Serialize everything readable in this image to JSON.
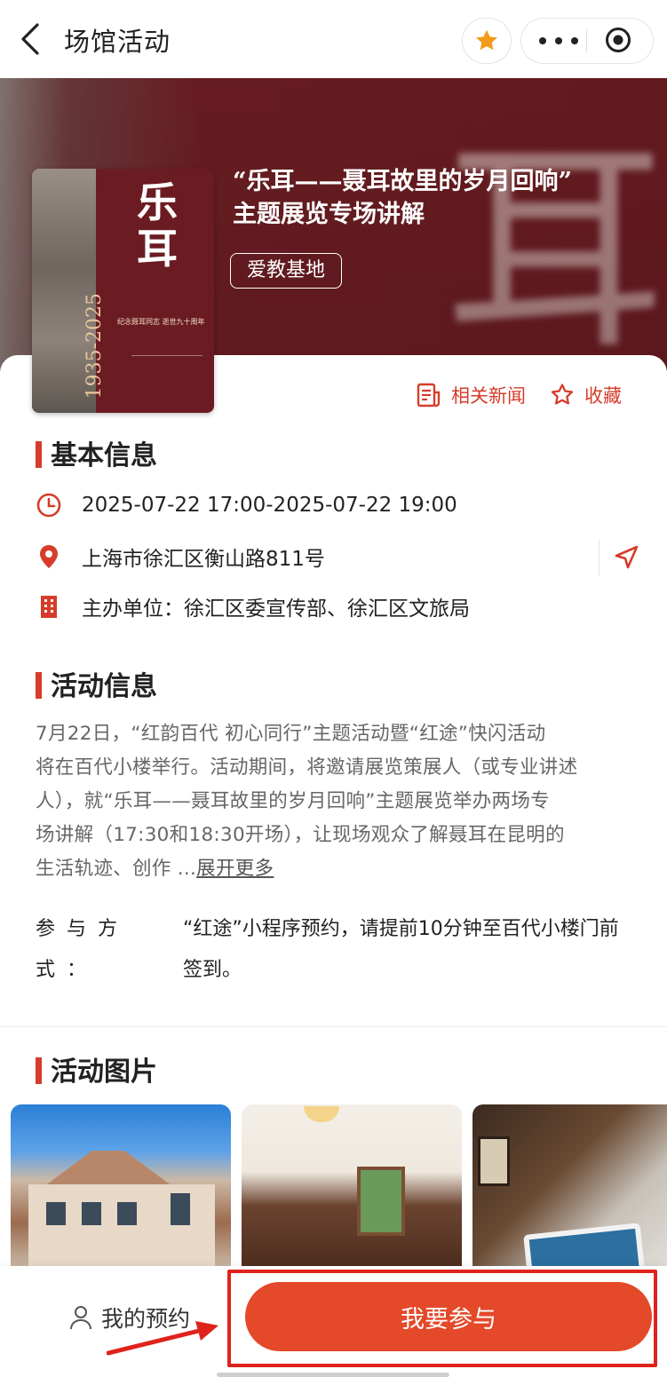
{
  "nav": {
    "title": "场馆活动"
  },
  "event": {
    "title_line1": "“乐耳——聂耳故里的岁月回响”",
    "title_line2": "主题展览专场讲解",
    "tag": "爱教基地"
  },
  "poster": {
    "big_text": "乐耳",
    "years": "1935-2025",
    "subtitle": "纪念聂耳同志 逝世九十周年"
  },
  "actions": {
    "news": "相关新闻",
    "favorite": "收藏"
  },
  "basic": {
    "title": "基本信息",
    "time": "2025-07-22 17:00-2025-07-22 19:00",
    "address": "上海市徐汇区衡山路811号",
    "host": "主办单位：徐汇区委宣传部、徐汇区文旅局"
  },
  "activity": {
    "title": "活动信息",
    "lines": [
      "7月22日，“红韵百代 初心同行”主题活动暨“红途”快闪活动",
      "将在百代小楼举行。活动期间，将邀请展览策展人（或专业讲述",
      "人），就“乐耳——聂耳故里的岁月回响”主题展览举办两场专",
      "场讲解（17:30和18:30开场），让现场观众了解聂耳在昆明的",
      "生活轨迹、创作 ..."
    ],
    "more": "展开更多",
    "join_label": "参与方式：",
    "join_text": "“红途”小程序预约，请提前10分钟至百代小楼门前签到。"
  },
  "photos": {
    "title": "活动图片"
  },
  "bottom": {
    "my_booking": "我的预约",
    "join": "我要参与"
  },
  "colors": {
    "accent": "#d63c2a",
    "button": "#e4492a",
    "banner": "#6b1c21",
    "highlight": "#e0221c"
  }
}
